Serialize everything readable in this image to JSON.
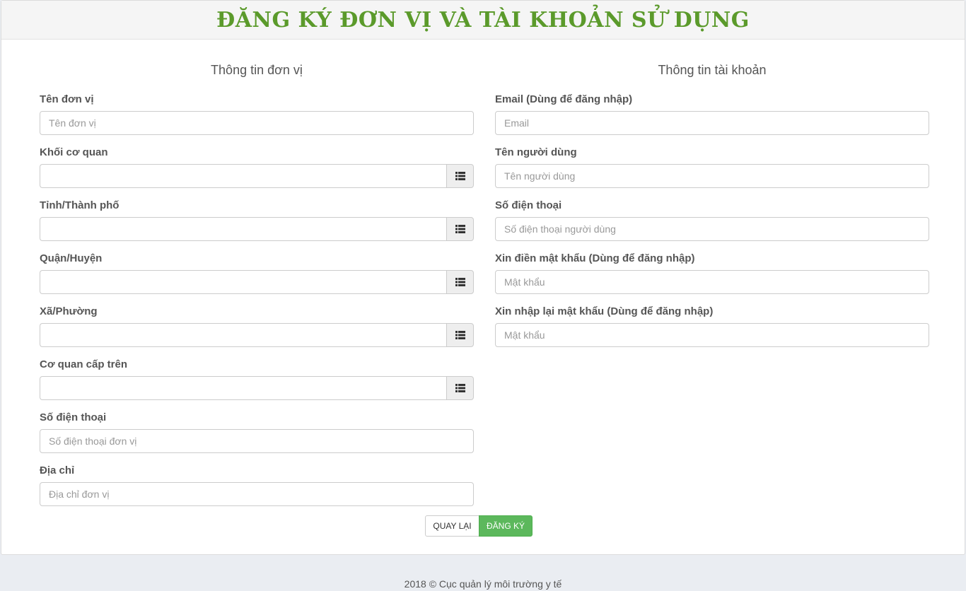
{
  "header": {
    "title": "ĐĂNG KÝ ĐƠN VỊ VÀ TÀI KHOẢN SỬ DỤNG"
  },
  "unit_section": {
    "title": "Thông tin đơn vị",
    "fields": {
      "name": {
        "label": "Tên đơn vị",
        "placeholder": "Tên đơn vị",
        "value": ""
      },
      "agency_block": {
        "label": "Khối cơ quan",
        "value": ""
      },
      "province": {
        "label": "Tỉnh/Thành phố",
        "value": ""
      },
      "district": {
        "label": "Quận/Huyện",
        "value": ""
      },
      "ward": {
        "label": "Xã/Phường",
        "value": ""
      },
      "parent_agency": {
        "label": "Cơ quan cấp trên",
        "value": ""
      },
      "phone": {
        "label": "Số điện thoại",
        "placeholder": "Số điện thoại đơn vị",
        "value": ""
      },
      "address": {
        "label": "Địa chỉ",
        "placeholder": "Địa chỉ đơn vị",
        "value": ""
      }
    }
  },
  "account_section": {
    "title": "Thông tin tài khoản",
    "fields": {
      "email": {
        "label": "Email (Dùng để đăng nhập)",
        "placeholder": "Email",
        "value": ""
      },
      "username": {
        "label": "Tên người dùng",
        "placeholder": "Tên người dùng",
        "value": ""
      },
      "phone": {
        "label": "Số điện thoại",
        "placeholder": "Số điện thoại người dùng",
        "value": ""
      },
      "password": {
        "label": "Xin điền mật khẩu (Dùng để đăng nhập)",
        "placeholder": "Mật khẩu",
        "value": ""
      },
      "password_confirm": {
        "label": "Xin nhập lại mật khẩu (Dùng để đăng nhập)",
        "placeholder": "Mật khẩu",
        "value": ""
      }
    }
  },
  "actions": {
    "back_label": "QUAY LẠI",
    "register_label": "ĐĂNG KÝ"
  },
  "footer": {
    "text": "2018 © Cục quản lý môi trường y tế"
  },
  "icons": {
    "list_button": "list-icon"
  },
  "colors": {
    "title_green": "#5b9a2b",
    "register_button": "#5cb85c",
    "page_background": "#eaedf2"
  }
}
